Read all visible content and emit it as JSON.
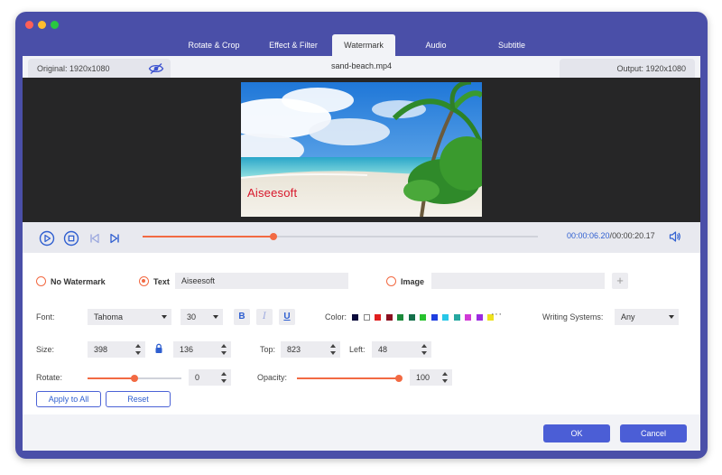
{
  "tabs": [
    {
      "label": "Rotate & Crop"
    },
    {
      "label": "Effect & Filter"
    },
    {
      "label": "Watermark"
    },
    {
      "label": "Audio"
    },
    {
      "label": "Subtitle"
    }
  ],
  "active_tab": "Watermark",
  "infobar": {
    "original": "Original: 1920x1080",
    "filename": "sand-beach.mp4",
    "output": "Output: 1920x1080"
  },
  "preview": {
    "watermark_text": "Aiseesoft",
    "watermark_color": "#d8172b"
  },
  "playback": {
    "current_time": "00:00:06.20",
    "separator": "/",
    "total_time": "00:00:20.17",
    "progress": 0.33
  },
  "watermark": {
    "no_watermark_label": "No Watermark",
    "text_label": "Text",
    "text_value": "Aiseesoft",
    "image_label": "Image",
    "image_value": ""
  },
  "font": {
    "label": "Font:",
    "family": "Tahoma",
    "size": "30",
    "bold": "B",
    "italic": "I",
    "underline": "U"
  },
  "color": {
    "label": "Color:",
    "swatches": [
      "#0b0b3b",
      "#ffffff",
      "#e11f1f",
      "#8b1020",
      "#1c8a3b",
      "#146f4a",
      "#28c22e",
      "#1f3fe0",
      "#28c7e8",
      "#26a7a0",
      "#d13ad6",
      "#9b2be0",
      "#eee21f"
    ],
    "more": "···"
  },
  "writing_systems": {
    "label": "Writing Systems:",
    "value": "Any"
  },
  "size": {
    "label": "Size:",
    "width": "398",
    "height": "136"
  },
  "position": {
    "top_label": "Top:",
    "top_value": "823",
    "left_label": "Left:",
    "left_value": "48"
  },
  "rotate": {
    "label": "Rotate:",
    "value": "0",
    "slider": 0.5
  },
  "opacity": {
    "label": "Opacity:",
    "value": "100",
    "slider": 1.0
  },
  "actions": {
    "apply_all": "Apply to All",
    "reset": "Reset",
    "ok": "OK",
    "cancel": "Cancel"
  },
  "colors": {
    "accent": "#f26a43",
    "primary": "#4b5ed6",
    "frame": "#4a4fa8"
  }
}
